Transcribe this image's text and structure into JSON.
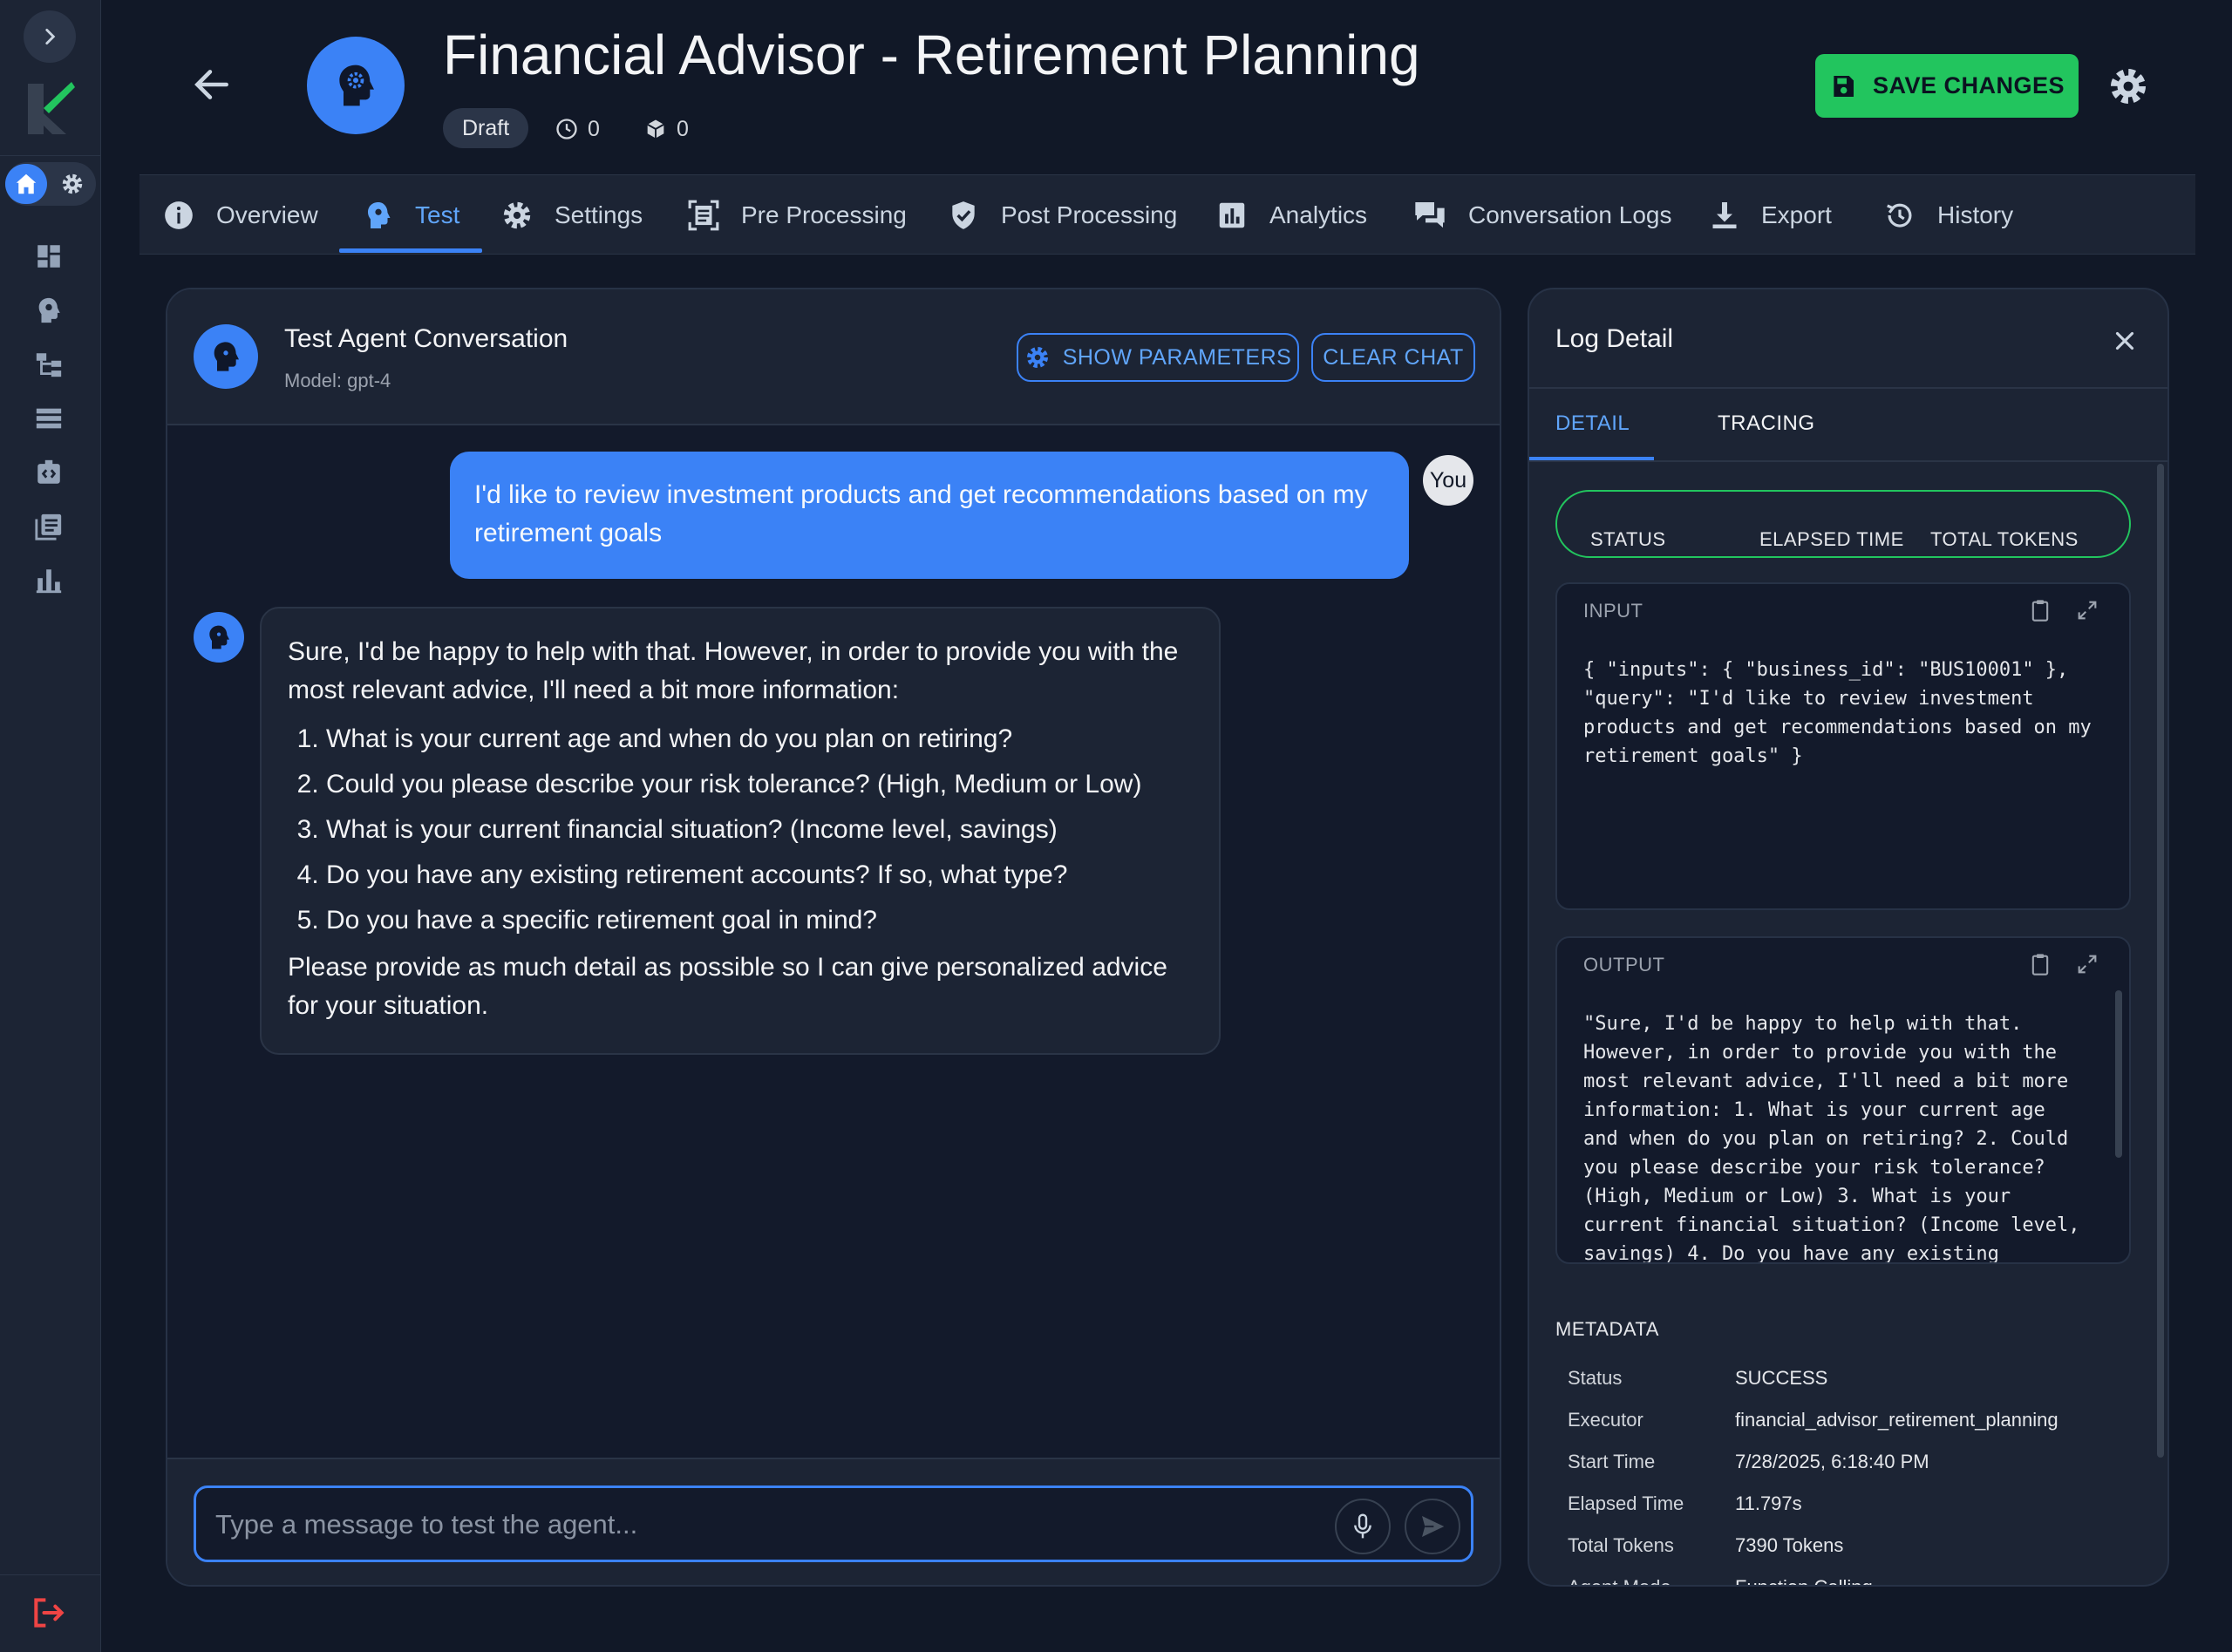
{
  "header": {
    "title": "Financial Advisor - Retirement Planning",
    "status_badge": "Draft",
    "runs_count": "0",
    "deploy_count": "0",
    "save_label": "SAVE CHANGES"
  },
  "tabs": [
    {
      "label": "Overview",
      "icon": "info-icon"
    },
    {
      "label": "Test",
      "icon": "agent-head-icon"
    },
    {
      "label": "Settings",
      "icon": "gear-icon"
    },
    {
      "label": "Pre Processing",
      "icon": "scan-doc-icon"
    },
    {
      "label": "Post Processing",
      "icon": "shield-check-icon"
    },
    {
      "label": "Analytics",
      "icon": "bar-chart-icon"
    },
    {
      "label": "Conversation Logs",
      "icon": "chat-bubbles-icon"
    },
    {
      "label": "Export",
      "icon": "download-icon"
    },
    {
      "label": "History",
      "icon": "history-icon"
    }
  ],
  "active_tab": "Test",
  "chat": {
    "title": "Test Agent Conversation",
    "model": "Model: gpt-4",
    "show_params_label": "SHOW PARAMETERS",
    "clear_label": "CLEAR CHAT",
    "user_message": "I'd like to review investment products and get recommendations based on my retirement goals",
    "user_avatar": "You",
    "bot_intro": "Sure, I'd be happy to help with that. However, in order to provide you with the most relevant advice, I'll need a bit more information:",
    "bot_questions": [
      "What is your current age and when do you plan on retiring?",
      "Could you please describe your risk tolerance? (High, Medium or Low)",
      "What is your current financial situation? (Income level, savings)",
      "Do you have any existing retirement accounts? If so, what type?",
      "Do you have a specific retirement goal in mind?"
    ],
    "bot_outro": "Please provide as much detail as possible so I can give personalized advice for your situation.",
    "input_placeholder": "Type a message to test the agent..."
  },
  "log": {
    "title": "Log Detail",
    "tabs": [
      "DETAIL",
      "TRACING"
    ],
    "active_tab": "DETAIL",
    "summary_headers": [
      "STATUS",
      "ELAPSED TIME",
      "TOTAL TOKENS"
    ],
    "input_label": "INPUT",
    "input_text": "{ \"inputs\": { \"business_id\": \"BUS10001\" },\n\"query\": \"I'd like to review investment\nproducts and get recommendations based on my\nretirement goals\" }",
    "output_label": "OUTPUT",
    "output_text": "\"Sure, I'd be happy to help with that.\nHowever, in order to provide you with the\nmost relevant advice, I'll need a bit more\ninformation: 1. What is your current age\nand when do you plan on retiring? 2. Could\nyou please describe your risk tolerance?\n(High, Medium or Low) 3. What is your\ncurrent financial situation? (Income level,\nsavings) 4. Do you have any existing",
    "metadata_title": "METADATA",
    "metadata": [
      {
        "key": "Status",
        "value": "SUCCESS"
      },
      {
        "key": "Executor",
        "value": "financial_advisor_retirement_planning"
      },
      {
        "key": "Start Time",
        "value": "7/28/2025, 6:18:40 PM"
      },
      {
        "key": "Elapsed Time",
        "value": "11.797s"
      },
      {
        "key": "Total Tokens",
        "value": "7390 Tokens"
      },
      {
        "key": "Agent Mode",
        "value": "Function Calling"
      }
    ]
  },
  "colors": {
    "background": "#111827",
    "panel": "#1c2434",
    "accent": "#3b82f6",
    "success": "#22c55e",
    "logout": "#ef4444"
  }
}
